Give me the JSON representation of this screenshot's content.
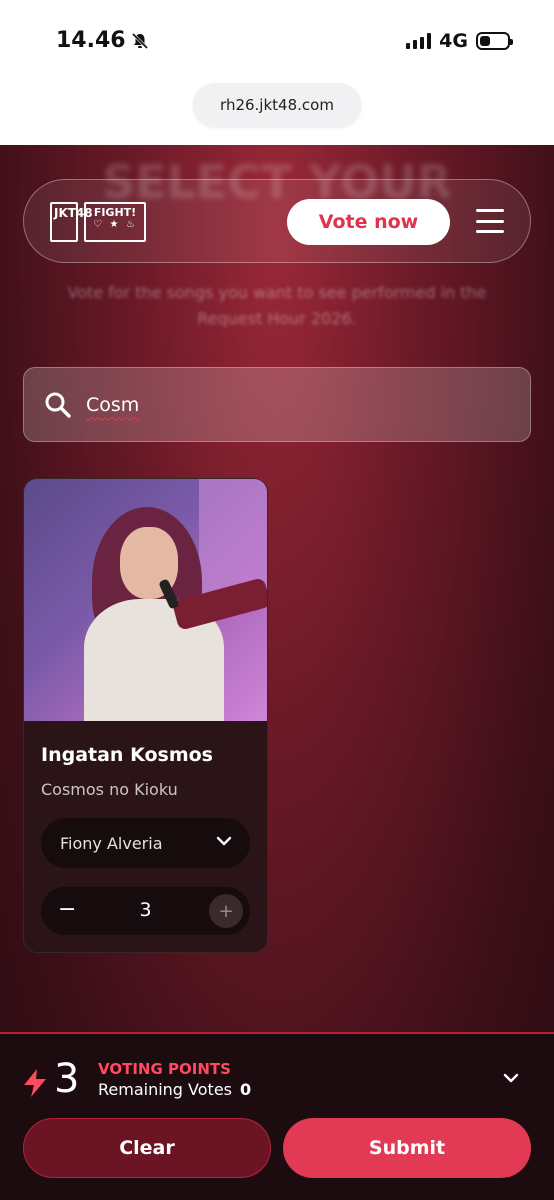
{
  "status_bar": {
    "time": "14.46",
    "network": "4G"
  },
  "browser": {
    "url": "rh26.jkt48.com"
  },
  "hero": {
    "title": "SELECT YOUR",
    "subtitle": "Vote for the songs you want to see performed in the Request Hour 2026."
  },
  "nav": {
    "logo_jkt": "JKT48",
    "logo_fight": "FIGHT!",
    "logo_fight_icons": "♡ ★ ♨",
    "vote_button": "Vote now",
    "menu_icon": "hamburger-icon"
  },
  "search": {
    "value": "Cosm",
    "icon": "search-icon"
  },
  "song_card": {
    "title": "Ingatan Kosmos",
    "subtitle": "Cosmos no Kioku",
    "member": "Fiony Alveria",
    "votes": "3",
    "minus": "−",
    "plus": "+"
  },
  "footer": {
    "points_digit": "3",
    "voting_points_label": "VOTING POINTS",
    "remaining_label": "Remaining Votes",
    "remaining_value": "0",
    "clear_button": "Clear",
    "submit_button": "Submit"
  },
  "colors": {
    "accent": "#e23a55",
    "background": "#6d1a28"
  }
}
